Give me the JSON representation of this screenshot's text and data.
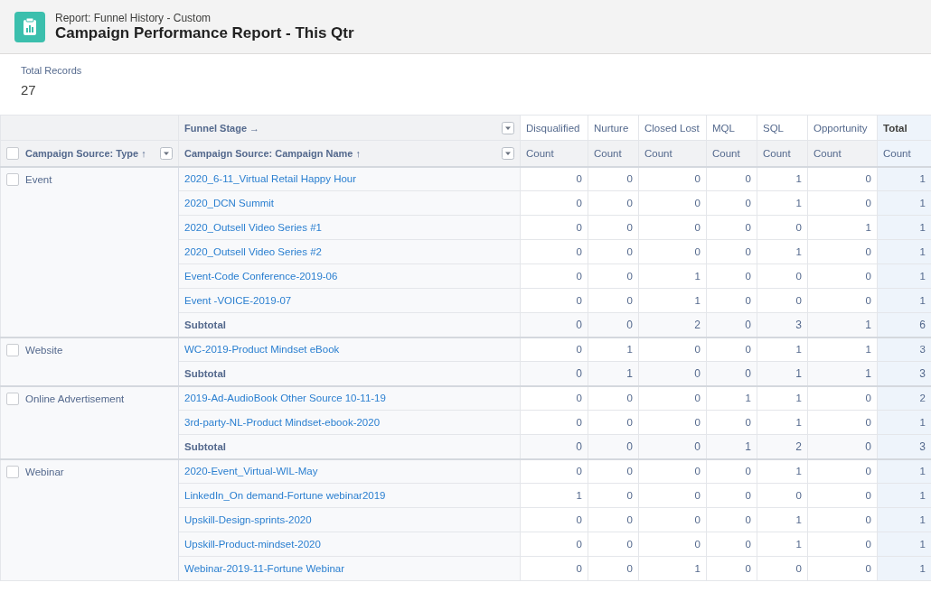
{
  "header": {
    "subtitle": "Report: Funnel History - Custom",
    "title": "Campaign Performance Report - This Qtr"
  },
  "summary": {
    "label": "Total Records",
    "value": "27"
  },
  "table": {
    "column_group": {
      "label": "Funnel Stage",
      "arrow": "→"
    },
    "row_columns": [
      {
        "label": "Campaign Source: Type",
        "sort": "↑"
      },
      {
        "label": "Campaign Source: Campaign Name",
        "sort": "↑"
      }
    ],
    "stages": [
      "Disqualified",
      "Nurture",
      "Closed Lost",
      "MQL",
      "SQL",
      "Opportunity"
    ],
    "total_label": "Total",
    "measures": [
      "Count",
      "Count",
      "Count",
      "Count",
      "Count",
      "Count",
      "Count"
    ],
    "select_all": {
      "checked": false
    },
    "groups": [
      {
        "type": "Event",
        "checked": false,
        "rows": [
          {
            "kind": "campaign",
            "name": "2020_6-11_Virtual Retail Happy Hour",
            "values": [
              "0",
              "0",
              "0",
              "0",
              "1",
              "0"
            ],
            "total": "1"
          },
          {
            "kind": "campaign",
            "name": "2020_DCN Summit",
            "values": [
              "0",
              "0",
              "0",
              "0",
              "1",
              "0"
            ],
            "total": "1"
          },
          {
            "kind": "campaign",
            "name": "2020_Outsell Video Series #1",
            "values": [
              "0",
              "0",
              "0",
              "0",
              "0",
              "1"
            ],
            "total": "1"
          },
          {
            "kind": "campaign",
            "name": "2020_Outsell Video Series #2",
            "values": [
              "0",
              "0",
              "0",
              "0",
              "1",
              "0"
            ],
            "total": "1"
          },
          {
            "kind": "campaign",
            "name": "Event-Code Conference-2019-06",
            "values": [
              "0",
              "0",
              "1",
              "0",
              "0",
              "0"
            ],
            "total": "1"
          },
          {
            "kind": "campaign",
            "name": "Event -VOICE-2019-07",
            "values": [
              "0",
              "0",
              "1",
              "0",
              "0",
              "0"
            ],
            "total": "1"
          },
          {
            "kind": "subtotal",
            "name": "Subtotal",
            "values": [
              "0",
              "0",
              "2",
              "0",
              "3",
              "1"
            ],
            "total": "6"
          }
        ]
      },
      {
        "type": "Website",
        "checked": false,
        "rows": [
          {
            "kind": "campaign",
            "name": "WC-2019-Product Mindset eBook",
            "values": [
              "0",
              "1",
              "0",
              "0",
              "1",
              "1"
            ],
            "total": "3"
          },
          {
            "kind": "subtotal",
            "name": "Subtotal",
            "values": [
              "0",
              "1",
              "0",
              "0",
              "1",
              "1"
            ],
            "total": "3"
          }
        ]
      },
      {
        "type": "Online Advertisement",
        "checked": false,
        "rows": [
          {
            "kind": "campaign",
            "name": "2019-Ad-AudioBook Other Source 10-11-19",
            "values": [
              "0",
              "0",
              "0",
              "1",
              "1",
              "0"
            ],
            "total": "2"
          },
          {
            "kind": "campaign",
            "name": "3rd-party-NL-Product Mindset-ebook-2020",
            "values": [
              "0",
              "0",
              "0",
              "0",
              "1",
              "0"
            ],
            "total": "1"
          },
          {
            "kind": "subtotal",
            "name": "Subtotal",
            "values": [
              "0",
              "0",
              "0",
              "1",
              "2",
              "0"
            ],
            "total": "3"
          }
        ]
      },
      {
        "type": "Webinar",
        "checked": false,
        "rows": [
          {
            "kind": "campaign",
            "name": "2020-Event_Virtual-WIL-May",
            "values": [
              "0",
              "0",
              "0",
              "0",
              "1",
              "0"
            ],
            "total": "1"
          },
          {
            "kind": "campaign",
            "name": "LinkedIn_On demand-Fortune webinar2019",
            "values": [
              "1",
              "0",
              "0",
              "0",
              "0",
              "0"
            ],
            "total": "1"
          },
          {
            "kind": "campaign",
            "name": "Upskill-Design-sprints-2020",
            "values": [
              "0",
              "0",
              "0",
              "0",
              "1",
              "0"
            ],
            "total": "1"
          },
          {
            "kind": "campaign",
            "name": "Upskill-Product-mindset-2020",
            "values": [
              "0",
              "0",
              "0",
              "0",
              "1",
              "0"
            ],
            "total": "1"
          },
          {
            "kind": "campaign",
            "name": "Webinar-2019-11-Fortune Webinar",
            "values": [
              "0",
              "0",
              "1",
              "0",
              "0",
              "0"
            ],
            "total": "1"
          }
        ]
      }
    ]
  }
}
